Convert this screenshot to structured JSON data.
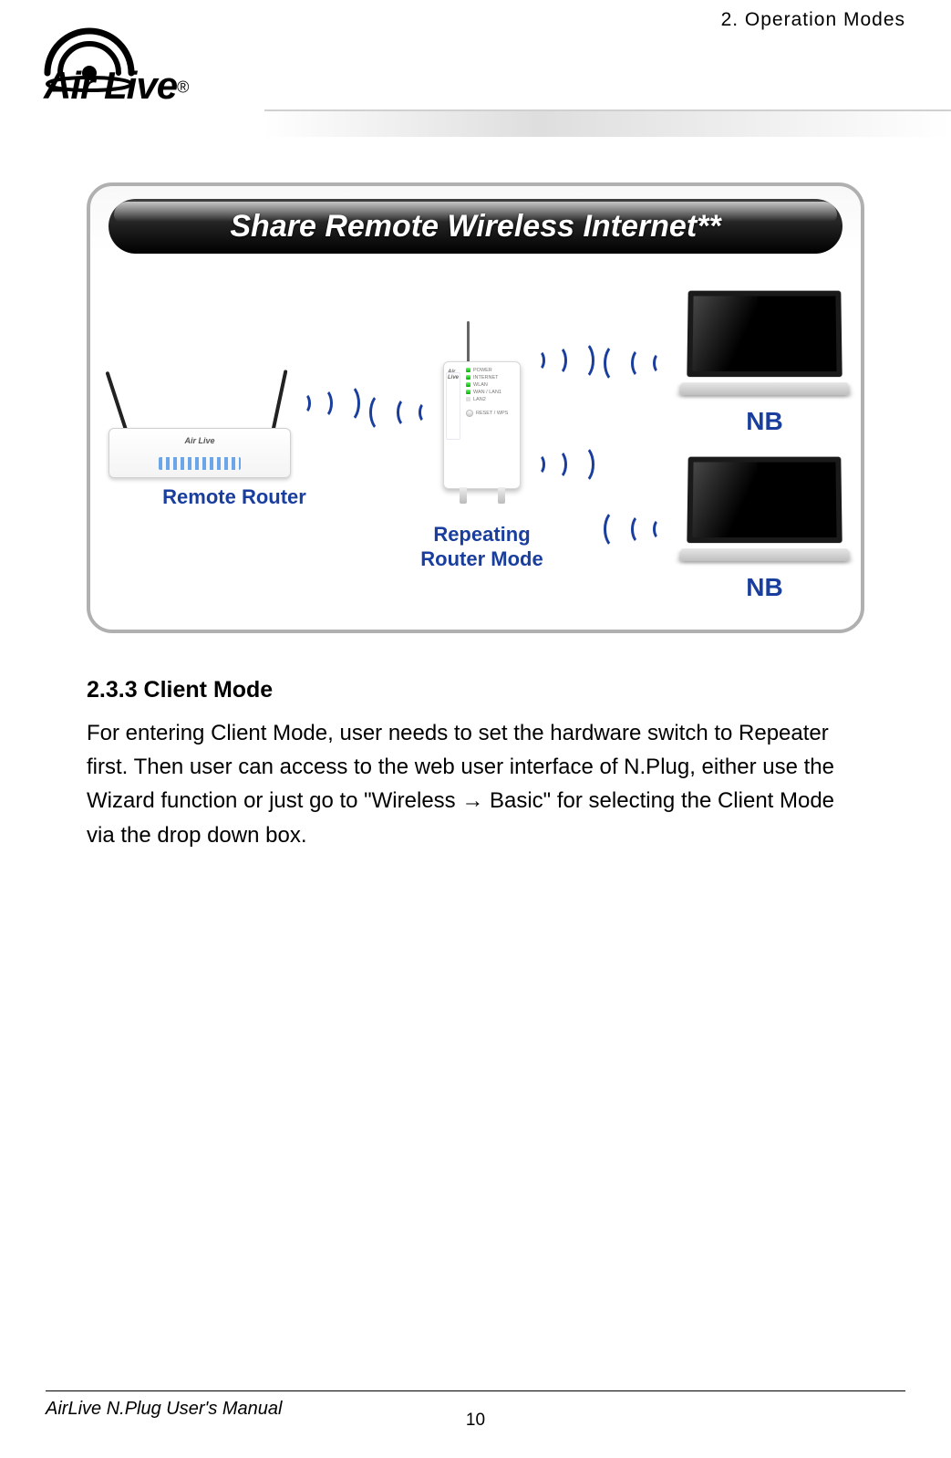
{
  "header": {
    "chapter_label": "2. Operation Modes",
    "logo_text": "Air Live",
    "registered_mark": "®"
  },
  "diagram": {
    "banner": "Share Remote Wireless Internet**",
    "remote_router_label": "Remote Router",
    "remote_router_device_logo": "Air Live",
    "center_device_logo": "Air Live",
    "center_device_leds": [
      {
        "color": "green",
        "label": "POWER"
      },
      {
        "color": "green",
        "label": "INTERNET"
      },
      {
        "color": "green",
        "label": "WLAN"
      },
      {
        "color": "green",
        "label": "WAN / LAN1"
      },
      {
        "color": "blank",
        "label": "LAN2"
      }
    ],
    "center_device_reset_label": "RESET / WPS",
    "center_label_line1": "Repeating",
    "center_label_line2": "Router Mode",
    "laptop_label": "NB"
  },
  "section": {
    "heading": "2.3.3  Client Mode",
    "body": "For entering Client Mode, user needs to set the hardware switch to Repeater first. Then user can access to the web user interface of N.Plug, either use the Wizard function or just go to \"Wireless → Basic\" for selecting the Client Mode via the drop down box."
  },
  "footer": {
    "left": "AirLive N.Plug User's Manual",
    "page_number": "10"
  }
}
